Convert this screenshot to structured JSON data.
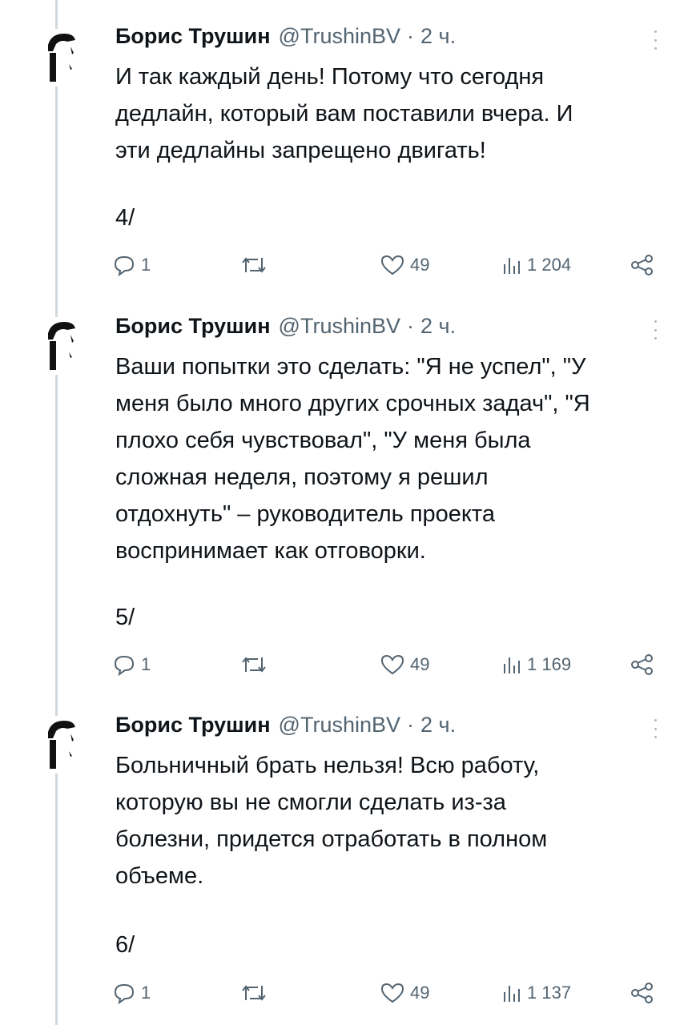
{
  "tweets": [
    {
      "author": "Борис Трушин",
      "handle": "@TrushinBV",
      "separator": "·",
      "time": "2 ч.",
      "text": "И так каждый день! Потому что сегодня\nдедлайн, который вам поставили вчера. И\nэти дедлайны запрещено двигать!",
      "counter": "4/",
      "replies": "1",
      "likes": "49",
      "views": "1 204"
    },
    {
      "author": "Борис Трушин",
      "handle": "@TrushinBV",
      "separator": "·",
      "time": "2 ч.",
      "text": "Ваши попытки это сделать: \"Я не успел\", \"У\nменя было много других срочных задач\", \"Я\nплохо себя чувствовал\", \"У меня была\nсложная неделя, поэтому я решил\nотдохнуть\" – руководитель проекта\nвоспринимает как отговорки.",
      "counter": "5/",
      "replies": "1",
      "likes": "49",
      "views": "1 169"
    },
    {
      "author": "Борис Трушин",
      "handle": "@TrushinBV",
      "separator": "·",
      "time": "2 ч.",
      "text": "Больничный брать нельзя! Всю работу,\nкоторую вы не смогли сделать из-за\nболезни, придется отработать в полном\nобъеме.",
      "counter": "6/",
      "replies": "1",
      "likes": "49",
      "views": "1 137"
    }
  ],
  "icons": {
    "reply": "reply-icon",
    "retweet": "retweet-icon",
    "like": "heart-icon",
    "views": "views-chart-icon",
    "share": "share-icon",
    "more": "more-vertical-icon"
  },
  "colors": {
    "text": "#0f1419",
    "secondary": "#536471",
    "thread_line": "#cfd9de"
  }
}
